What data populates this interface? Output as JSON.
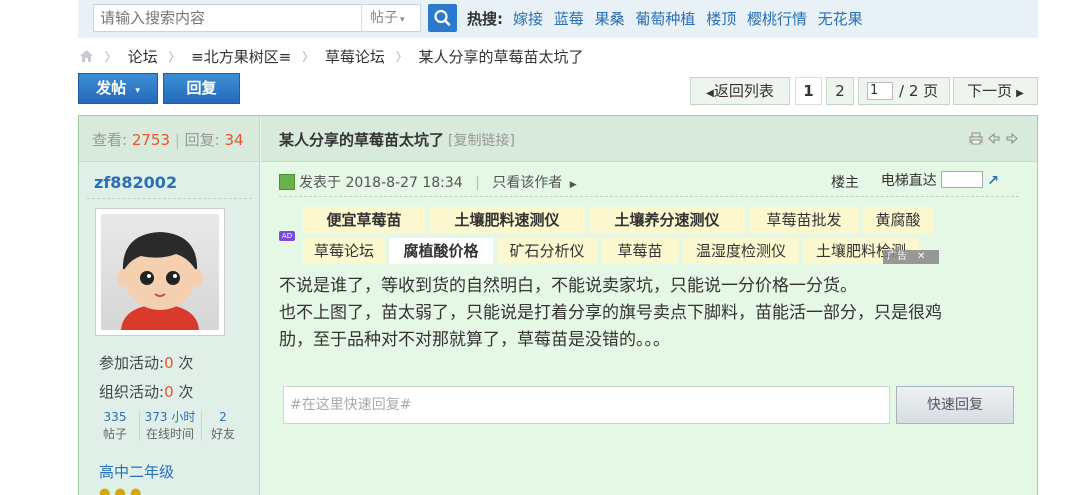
{
  "search": {
    "placeholder": "请输入搜索内容",
    "type_label": "帖子",
    "hot_label": "热搜:",
    "hot_links": [
      "嫁接",
      "蓝莓",
      "果桑",
      "葡萄种植",
      "楼顶",
      "樱桃行情",
      "无花果"
    ]
  },
  "breadcrumb": {
    "items": [
      "论坛",
      "≡北方果树区≡",
      "草莓论坛",
      "某人分享的草莓苗太坑了"
    ]
  },
  "actions": {
    "post_label": "发帖",
    "reply_label": "回复"
  },
  "pager": {
    "back_label": "返回列表",
    "pages": [
      "1",
      "2"
    ],
    "current_input": "1",
    "total_label": "/ 2 页",
    "next_label": "下一页"
  },
  "sidebar": {
    "views_label": "查看:",
    "views_value": "2753",
    "replies_label": "回复:",
    "replies_value": "34",
    "username": "zf882002",
    "activity_join_label": "参加活动:",
    "activity_join_value": "0",
    "activity_join_unit": "次",
    "activity_org_label": "组织活动:",
    "activity_org_value": "0",
    "activity_org_unit": "次",
    "posts_value": "335",
    "posts_label": "帖子",
    "online_value": "373 小时",
    "online_label": "在线时间",
    "friends_value": "2",
    "friends_label": "好友",
    "grade": "高中二年级"
  },
  "post": {
    "title": "某人分享的草莓苗太坑了",
    "copy_link_label": "[复制链接]",
    "posted_label": "发表于 2018-8-27 18:34",
    "author_only_label": "只看该作者",
    "floor_label": "楼主",
    "elevator_label": "电梯直达",
    "ad_row1": [
      "便宜草莓苗",
      "土壤肥料速测仪",
      "土壤养分速测仪",
      "草莓苗批发",
      "黄腐酸"
    ],
    "ad_row2": [
      "草莓论坛",
      "腐植酸价格",
      "矿石分析仪",
      "草莓苗",
      "温湿度检测仪",
      "土壤肥料检测"
    ],
    "ad_badge": "AD",
    "ad_close_label": "广告",
    "content_lines": [
      "不说是谁了，等收到货的自然明白，不能说卖家坑，只能说一分价格一分货。",
      "也不上图了，苗太弱了，只能说是打着分享的旗号卖点下脚料，苗能活一部分，只是很鸡",
      "肋，至于品种对不对那就算了，草莓苗是没错的。。。"
    ],
    "quick_reply_placeholder": "#在这里快速回复#",
    "quick_reply_button": "快速回复"
  }
}
